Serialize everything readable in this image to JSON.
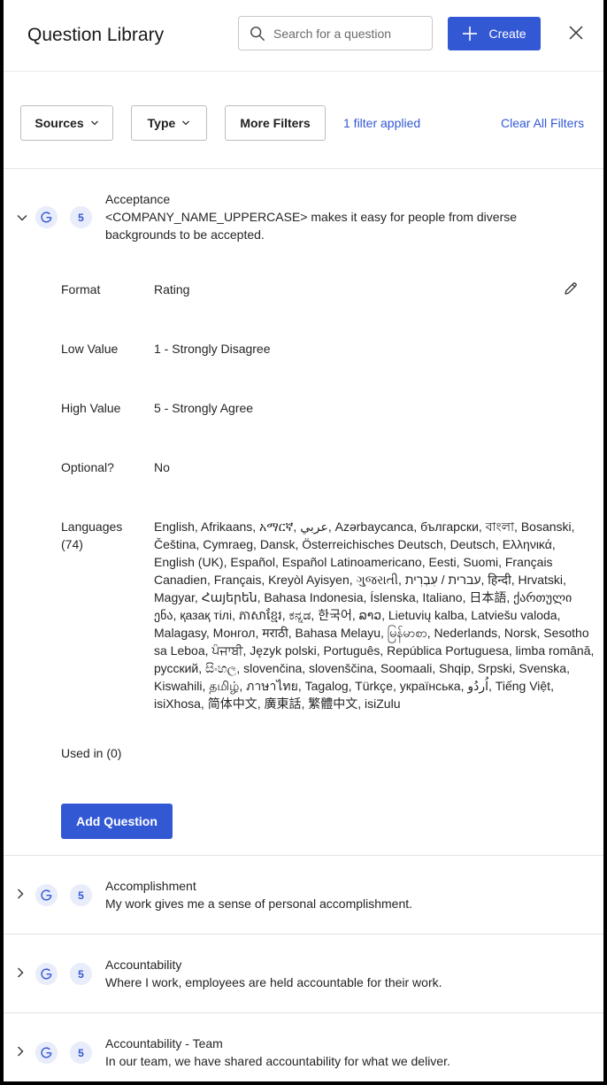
{
  "header": {
    "title": "Question Library",
    "search_placeholder": "Search for a question",
    "create_label": "Create"
  },
  "filters": {
    "sources_label": "Sources",
    "type_label": "Type",
    "more_filters_label": "More Filters",
    "applied_label": "1 filter applied",
    "clear_label": "Clear All Filters"
  },
  "expanded_question": {
    "name": "Acceptance",
    "text": "<COMPANY_NAME_UPPERCASE> makes it easy for people from diverse backgrounds to be accepted.",
    "scale_count": "5",
    "details": {
      "format_label": "Format",
      "format_value": "Rating",
      "low_label": "Low Value",
      "low_value": "1 - Strongly Disagree",
      "high_label": "High Value",
      "high_value": "5 - Strongly Agree",
      "optional_label": "Optional?",
      "optional_value": "No",
      "languages_label": "Languages",
      "languages_count": "(74)",
      "languages_value": "English, Afrikaans, አማርኛ, عربي, Azərbaycanca, български, বাংলা, Bosanski, Čeština, Cymraeg, Dansk, Österreichisches Deutsch, Deutsch, Ελληνικά, English (UK), Español, Español Latinoamericano, Eesti, Suomi, Français Canadien, Français, Kreyòl Ayisyen, ગુજરાતી, עברית / עִבְרִית, हिन्दी, Hrvatski, Magyar, Հայերեն, Bahasa Indonesia, Íslenska, Italiano, 日本語, ქართული ენა, қазақ тілі, ភាសាខ្មែរ, ಕನ್ನಡ, 한국어, ລາວ, Lietuvių kalba, Latviešu valoda, Malagasy, Монгол, मराठी, Bahasa Melayu, မြန်မာစာ, Nederlands, Norsk, Sesotho sa Leboa, ਪੰਜਾਬੀ, Język polski, Português, República Portuguesa, limba română, русский, සිංහල, slovenčina, slovenščina, Soomaali, Shqip, Srpski, Svenska, Kiswahili, தமிழ், ภาษาไทย, Tagalog, Türkçe, українська, اُردُو, Tiếng Việt, isiXhosa, 简体中文, 廣東話, 繁體中文, isiZulu",
      "used_in_label": "Used in (0)"
    },
    "add_label": "Add Question"
  },
  "questions": [
    {
      "name": "Accomplishment",
      "text": "My work gives me a sense of personal accomplishment.",
      "scale_count": "5"
    },
    {
      "name": "Accountability",
      "text": "Where I work, employees are held accountable for their work.",
      "scale_count": "5"
    },
    {
      "name": "Accountability - Team",
      "text": "In our team, we have shared accountability for what we deliver.",
      "scale_count": "5"
    }
  ],
  "colors": {
    "accent": "#3358d4",
    "badge_bg": "#e8ecfb"
  },
  "icons": {
    "search": "search-icon",
    "create": "plus-icon",
    "close": "close-icon",
    "dropdown": "chevron-down-icon",
    "expand": "chevron-right-icon",
    "source": "google-g-icon",
    "edit": "pencil-icon"
  }
}
